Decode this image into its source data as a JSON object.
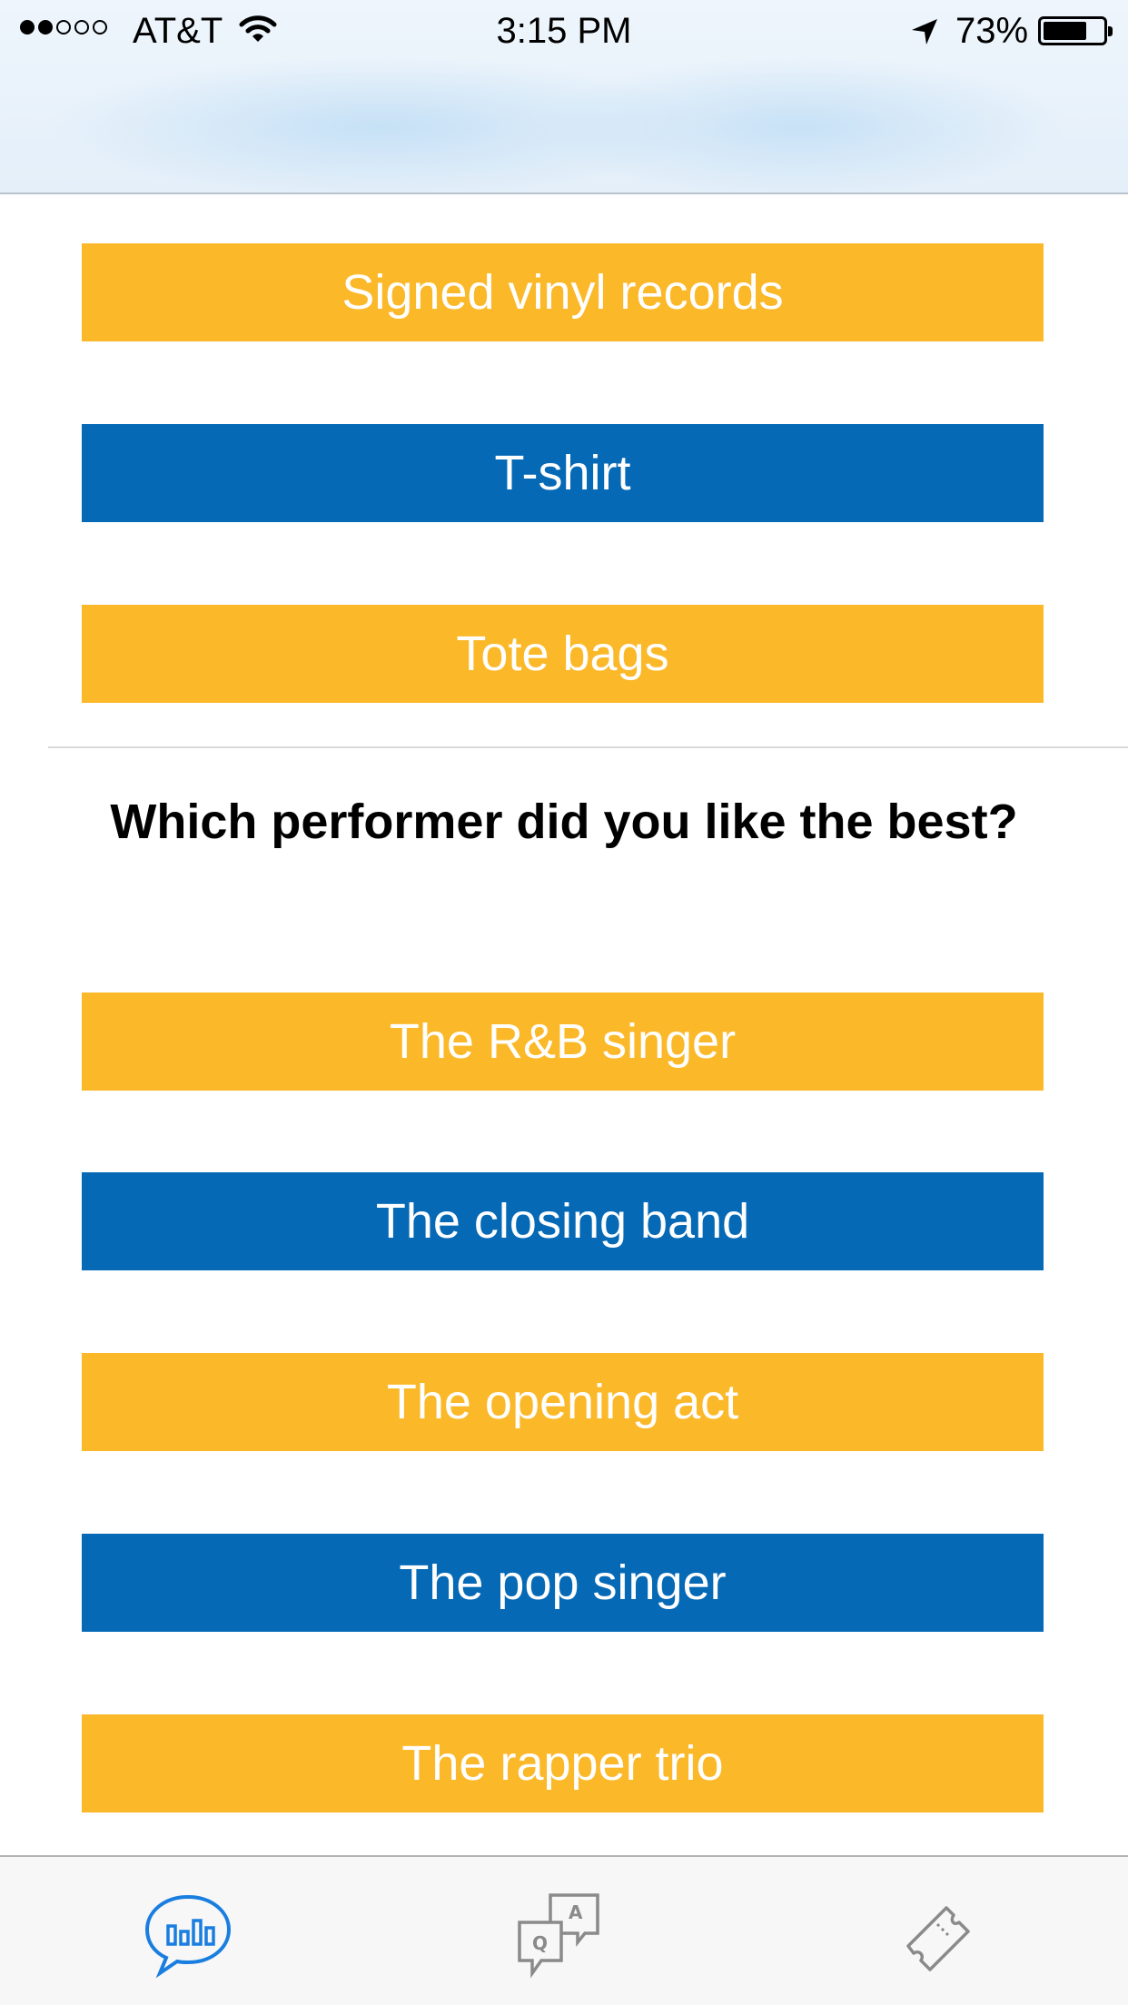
{
  "status_bar": {
    "carrier": "AT&T",
    "time": "3:15 PM",
    "battery_percent": "73%",
    "battery_level": 0.73,
    "signal_bars_filled": 2,
    "signal_bars_total": 5
  },
  "section_one": {
    "options": [
      {
        "label": "Signed vinyl records",
        "color": "#fbb829"
      },
      {
        "label": "T-shirt",
        "color": "#0569b6"
      },
      {
        "label": "Tote bags",
        "color": "#fbb829"
      }
    ]
  },
  "section_two": {
    "question": "Which performer did you like the best?",
    "options": [
      {
        "label": "The R&B singer",
        "color": "#fbb829"
      },
      {
        "label": "The closing band",
        "color": "#0569b6"
      },
      {
        "label": "The opening act",
        "color": "#fbb829"
      },
      {
        "label": "The pop singer",
        "color": "#0569b6"
      },
      {
        "label": "The rapper trio",
        "color": "#fbb829"
      }
    ]
  },
  "tab_bar": {
    "tabs": [
      {
        "icon": "poll-chat-icon",
        "active": true,
        "color": "#1a7ee0"
      },
      {
        "icon": "qa-chat-icon",
        "active": false,
        "color": "#8a8a8a"
      },
      {
        "icon": "ticket-icon",
        "active": false,
        "color": "#8a8a8a"
      }
    ]
  }
}
